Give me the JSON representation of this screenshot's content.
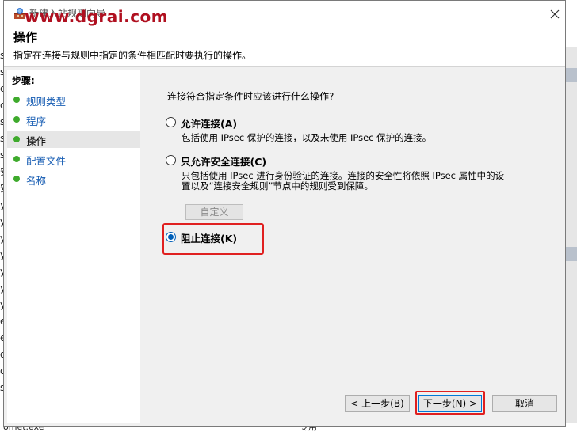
{
  "background": {
    "left_fragments": [
      "s",
      "se",
      "ci",
      "ci",
      "se",
      "s",
      "s",
      "安",
      "安",
      "y",
      "y",
      "y",
      "y",
      "y",
      "y",
      "y",
      "er",
      "er",
      "o",
      "o",
      "s"
    ],
    "bottom_left": "omet.exe",
    "bottom_right": "专用"
  },
  "dialog": {
    "title": "新建入站规则向导",
    "watermark": "www.dgrai.com",
    "header": {
      "title": "操作",
      "subtitle": "指定在连接与规则中指定的条件相匹配时要执行的操作。"
    },
    "steps": {
      "title": "步骤:",
      "items": [
        {
          "label": "规则类型",
          "active": false
        },
        {
          "label": "程序",
          "active": false
        },
        {
          "label": "操作",
          "active": true
        },
        {
          "label": "配置文件",
          "active": false
        },
        {
          "label": "名称",
          "active": false
        }
      ]
    },
    "main": {
      "question": "连接符合指定条件时应该进行什么操作?",
      "options": [
        {
          "label": "允许连接(A)",
          "checked": false,
          "desc": [
            "包括使用 IPsec 保护的连接，以及未使用 IPsec 保护的连接。"
          ]
        },
        {
          "label": "只允许安全连接(C)",
          "checked": false,
          "desc": [
            "只包括使用 IPsec 进行身份验证的连接。连接的安全性将依照 IPsec 属性中的设",
            "置以及“连接安全规则”节点中的规则受到保障。"
          ]
        },
        {
          "label": "阻止连接(K)",
          "checked": true,
          "desc": []
        }
      ],
      "customize_label": "自定义"
    },
    "buttons": {
      "back": "< 上一步(B)",
      "next": "下一步(N) >",
      "cancel": "取消"
    },
    "colors": {
      "accent": "#005fb8",
      "step_dot": "#3eaa2c",
      "highlight": "#e02020"
    }
  }
}
